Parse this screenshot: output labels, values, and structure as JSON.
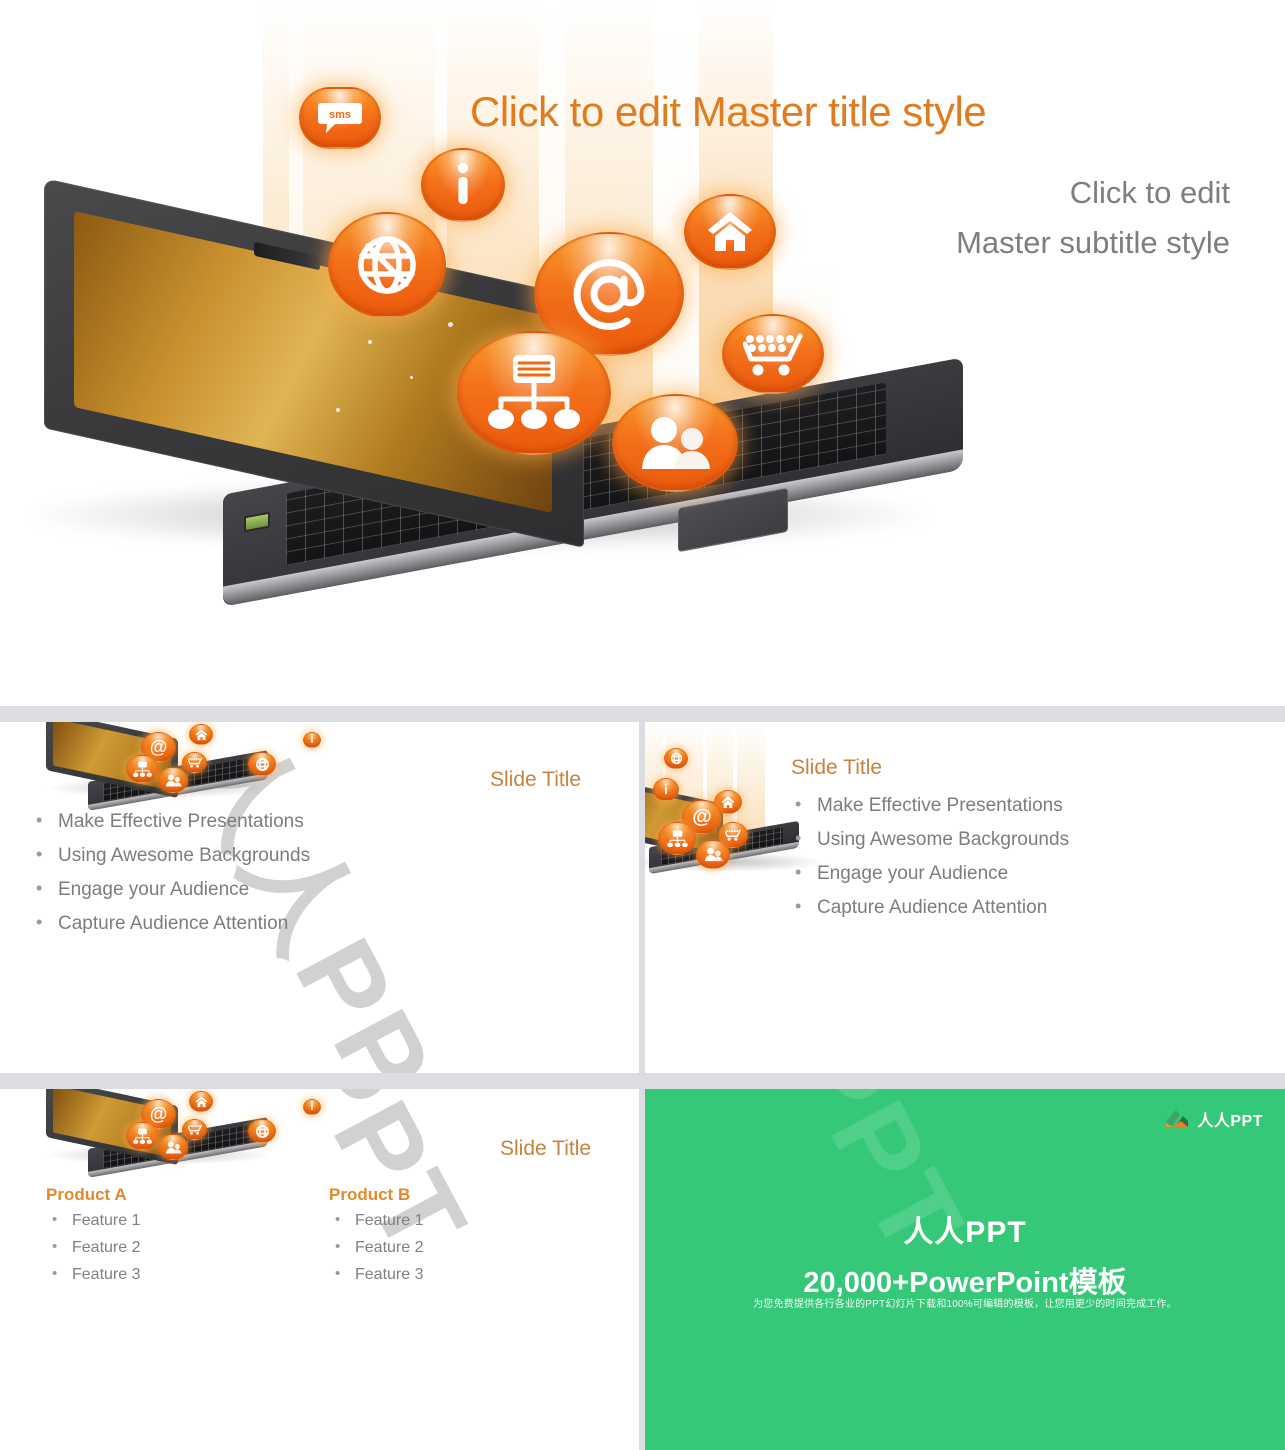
{
  "hero": {
    "title": "Click to edit Master title style",
    "subtitle_line1": "Click to edit",
    "subtitle_line2": "Master subtitle style",
    "sms_label": "sms",
    "title_color": "#E07B1E",
    "subtitle_color": "#7E7E7E",
    "icons": [
      {
        "name": "sms-icon",
        "label": "sms"
      },
      {
        "name": "info-icon",
        "label": "i"
      },
      {
        "name": "globe-icon",
        "label": ""
      },
      {
        "name": "email-at-icon",
        "label": "@"
      },
      {
        "name": "home-icon",
        "label": ""
      },
      {
        "name": "sitemap-icon",
        "label": ""
      },
      {
        "name": "shopping-cart-icon",
        "label": ""
      },
      {
        "name": "users-icon",
        "label": ""
      }
    ]
  },
  "slide_bullets": {
    "title": "Slide Title",
    "items": [
      "Make Effective Presentations",
      "Using Awesome Backgrounds",
      "Engage your Audience",
      "Capture Audience Attention"
    ]
  },
  "slide_bullets_right": {
    "title": "Slide Title",
    "items": [
      "Make Effective Presentations",
      "Using Awesome Backgrounds",
      "Engage your Audience",
      "Capture Audience Attention"
    ]
  },
  "slide_products": {
    "title": "Slide Title",
    "columns": [
      {
        "heading": "Product A",
        "features": [
          "Feature 1",
          "Feature 2",
          "Feature 3"
        ]
      },
      {
        "heading": "Product B",
        "features": [
          "Feature 1",
          "Feature 2",
          "Feature 3"
        ]
      }
    ]
  },
  "watermark": {
    "text": "人人PPT",
    "color": "#CFCFCF"
  },
  "promo": {
    "logo_text": "人人PPT",
    "heading": "人人PPT",
    "subheading": "20,000+PowerPoint模板",
    "note": "为您免费提供各行各业的PPT幻灯片下载和100%可编辑的模板，让您用更少的时间完成工作。",
    "background_color": "#35C878"
  },
  "theme": {
    "accent_orange": "#EA5A0C",
    "title_orange": "#C9823C",
    "product_orange": "#E08A2B",
    "body_gray": "#7D7D7D",
    "divider_gray": "#DCDDE0"
  }
}
